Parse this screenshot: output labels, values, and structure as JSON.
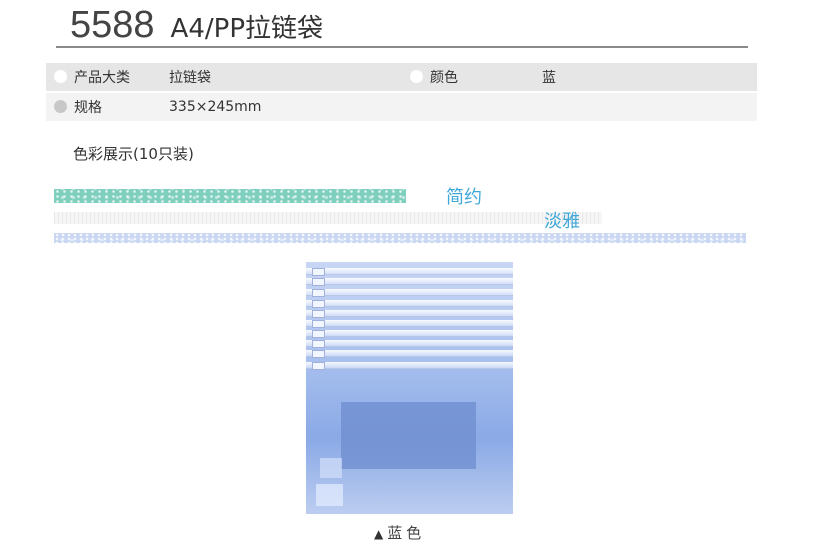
{
  "header": {
    "model_number": "5588",
    "title": "A4/PP拉链袋"
  },
  "spec": {
    "row1": {
      "label1": "产品大类",
      "value1": "拉链袋",
      "label2": "颜色",
      "value2": "蓝"
    },
    "row2": {
      "label1": "规格",
      "value1": "335×245mm"
    }
  },
  "section": {
    "color_display": "色彩展示(10只装)"
  },
  "bands": {
    "word1": "简约",
    "word2": "淡雅"
  },
  "product": {
    "triangle": "▲",
    "caption": "蓝色"
  },
  "colors": {
    "accent_text": "#3fa8d8",
    "teal_band": "#7fcfbf",
    "blue_band": "#c9d7f2",
    "bag_blue": "#8aa9e6"
  }
}
